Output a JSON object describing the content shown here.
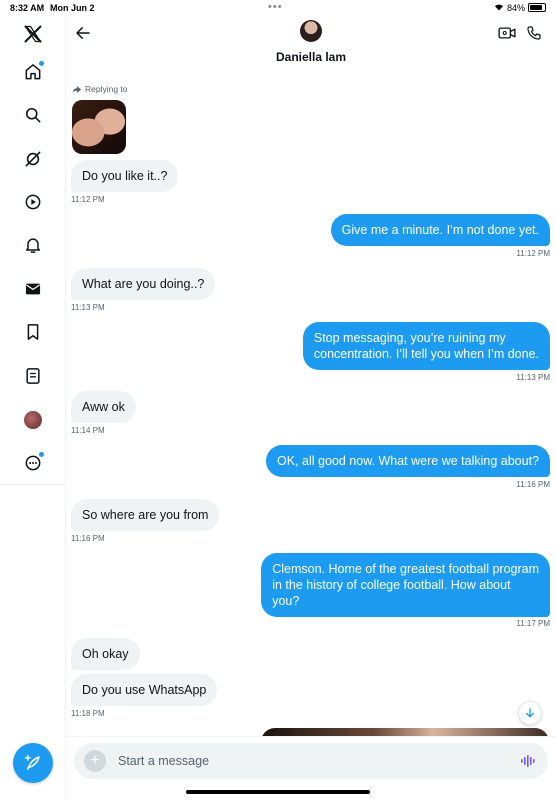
{
  "status_bar": {
    "time": "8:32 AM",
    "date": "Mon Jun 2",
    "battery": "84%"
  },
  "sidebar": {
    "items": [
      {
        "name": "x-logo",
        "icon": "x-logo-icon"
      },
      {
        "name": "home",
        "icon": "home-icon",
        "badge": true
      },
      {
        "name": "explore",
        "icon": "search-icon"
      },
      {
        "name": "grok",
        "icon": "grok-icon"
      },
      {
        "name": "video",
        "icon": "play-icon"
      },
      {
        "name": "notifications",
        "icon": "bell-icon"
      },
      {
        "name": "messages",
        "icon": "envelope-icon"
      },
      {
        "name": "bookmarks",
        "icon": "bookmark-icon"
      },
      {
        "name": "lists",
        "icon": "list-icon"
      },
      {
        "name": "profile",
        "icon": "avatar"
      },
      {
        "name": "more",
        "icon": "more-icon",
        "badge": true
      }
    ],
    "compose_icon": "compose-icon"
  },
  "header": {
    "name": "Daniella lam"
  },
  "conversation": {
    "reply_label": "Replying to",
    "messages": [
      {
        "dir": "in",
        "text": "Do you like it..?",
        "time": "11:12 PM"
      },
      {
        "dir": "out",
        "text": "Give me a minute.  I’m not done yet.",
        "time": "11:12 PM"
      },
      {
        "dir": "in",
        "text": "What are you doing..?",
        "time": "11:13 PM"
      },
      {
        "dir": "out",
        "text": "Stop messaging, you’re ruining my\nconcentration.  I’ll tell you when I’m done.",
        "time": "11:13 PM"
      },
      {
        "dir": "in",
        "text": "Aww ok",
        "time": "11:14 PM"
      },
      {
        "dir": "out",
        "text": "OK, all good now.  What were we talking about?",
        "time": "11:16 PM"
      },
      {
        "dir": "in",
        "text": "So where are you from",
        "time": "11:16 PM"
      },
      {
        "dir": "out",
        "text": "Clemson.  Home of the greatest football program\nin the history of college football.  How about\nyou?",
        "time": "11:17 PM"
      },
      {
        "dir": "in",
        "text": "Oh okay",
        "time": ""
      },
      {
        "dir": "in",
        "text": "Do you use WhatsApp",
        "time": "11:18 PM"
      }
    ]
  },
  "composer": {
    "placeholder": "Start a message"
  },
  "colors": {
    "accent": "#1d9bf0",
    "incoming_bubble": "#eff3f4",
    "text_secondary": "#536471"
  }
}
